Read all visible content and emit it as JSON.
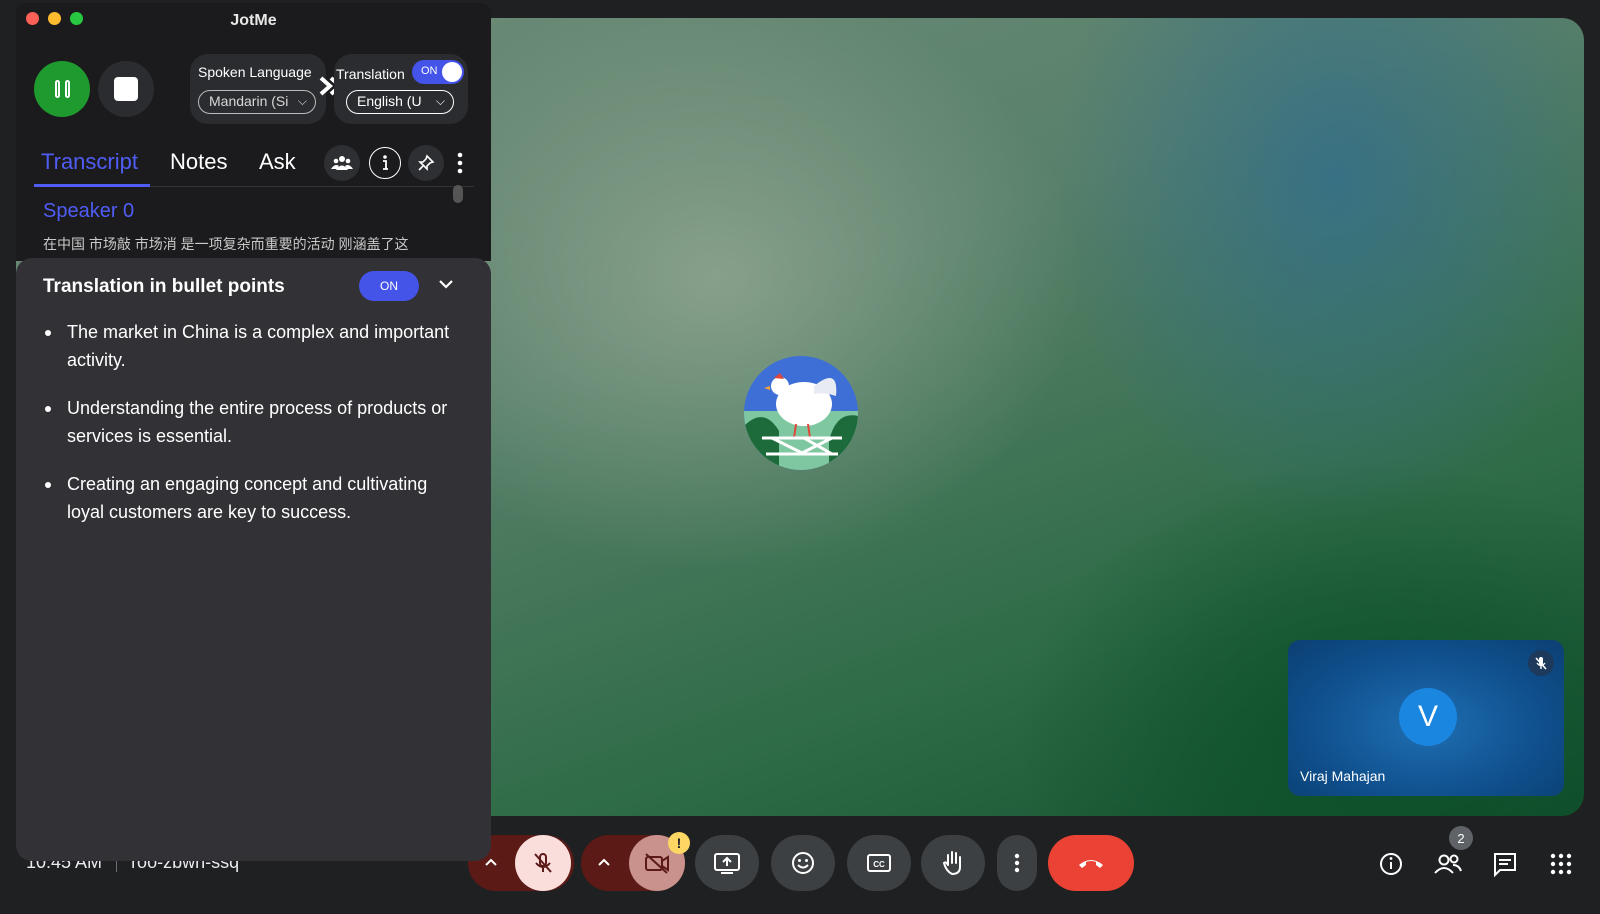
{
  "window": {
    "title": "JotMe"
  },
  "language": {
    "spoken_label": "Spoken Language",
    "spoken_value": "Mandarin (Si",
    "translation_label": "Translation",
    "translation_toggle": "ON",
    "target_value": "English (U"
  },
  "tabs": [
    {
      "label": "Transcript"
    },
    {
      "label": "Notes"
    },
    {
      "label": "Ask"
    }
  ],
  "transcript": {
    "speaker": "Speaker 0",
    "line": "在中国 市场敲 市场消 是一项复杂而重要的活动 刚涵盖了这"
  },
  "translation_panel": {
    "title": "Translation in bullet points",
    "toggle": "ON",
    "bullets": [
      "The market in China is a complex and important activity.",
      "Understanding the entire process of products or services is essential.",
      "Creating an engaging concept and cultivating loyal customers are key to success."
    ]
  },
  "meeting": {
    "time": "10:45 AM",
    "code": "roo-zbwn-ssq",
    "self_name": "Viraj Mahajan",
    "self_initial": "V",
    "participants_count": "2",
    "camera_warning": "!"
  },
  "colors": {
    "accent": "#4f5df5",
    "record_green": "#1f9a2e",
    "end_call_red": "#ea4335",
    "panel_bg": "#323236"
  }
}
